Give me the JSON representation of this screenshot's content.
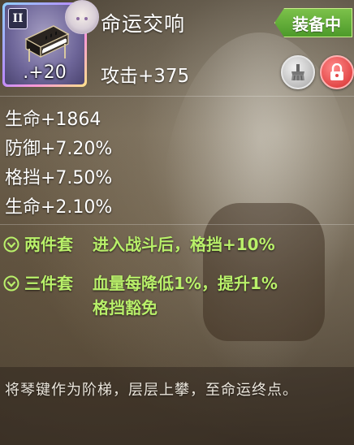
{
  "item": {
    "tier": "II",
    "level": ".+20",
    "icon": "piano-icon",
    "title": "命运交响",
    "main_stat": "攻击+375",
    "equipped_label": "装备中"
  },
  "actions": {
    "broom_icon": "broom-icon",
    "lock_icon": "lock-icon"
  },
  "sub_stats": [
    "生命+1864",
    "防御+7.20%",
    "格挡+7.50%",
    "生命+2.10%"
  ],
  "set_bonuses": [
    {
      "name": "两件套",
      "description": "进入战斗后，格挡+10%"
    },
    {
      "name": "三件套",
      "description": "血量每降低1%，提升1%\n格挡豁免"
    }
  ],
  "lore": "将琴键作为阶梯，层层上攀，至命运终点。",
  "colors": {
    "set_text": "#b9f06a",
    "equipped_badge": "#5aa832",
    "lock_button": "#e34848"
  }
}
